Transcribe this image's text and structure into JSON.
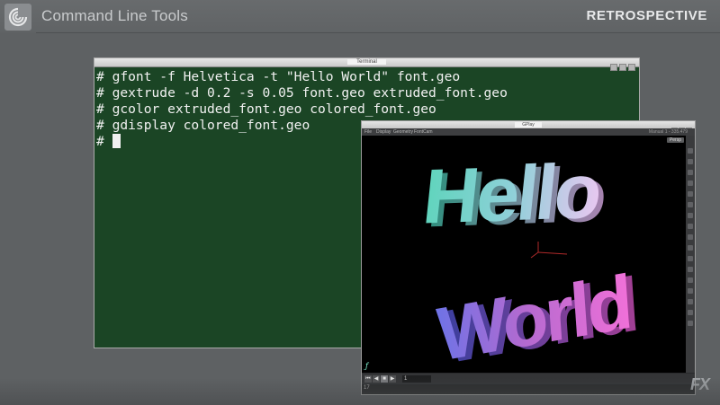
{
  "slide": {
    "title": "Command Line Tools",
    "tag": "RETROSPECTIVE",
    "watermark": "FX"
  },
  "terminal": {
    "title": "Terminal",
    "lines": [
      "# gfont -f Helvetica -t \"Hello World\" font.geo",
      "# gextrude -d 0.2 -s 0.05 font.geo extruded_font.geo",
      "# gcolor extruded_font.geo colored_font.geo",
      "# gdisplay colored_font.geo",
      "# "
    ]
  },
  "gplay": {
    "title": "GPlay",
    "menu": [
      "File",
      "Display",
      "Geometry",
      "FontCam"
    ],
    "readout": "Manual 1 - 335.479",
    "view_button": "Persp",
    "frame": "1",
    "status_frame": "17",
    "viewport_text": {
      "line1": "Hello",
      "line2": "World"
    }
  },
  "colors": {
    "terminal_bg": "#1b4525",
    "terminal_fg": "#f1f1f1",
    "slide_bg": "#5e6163",
    "viewport_bg": "#000000"
  }
}
